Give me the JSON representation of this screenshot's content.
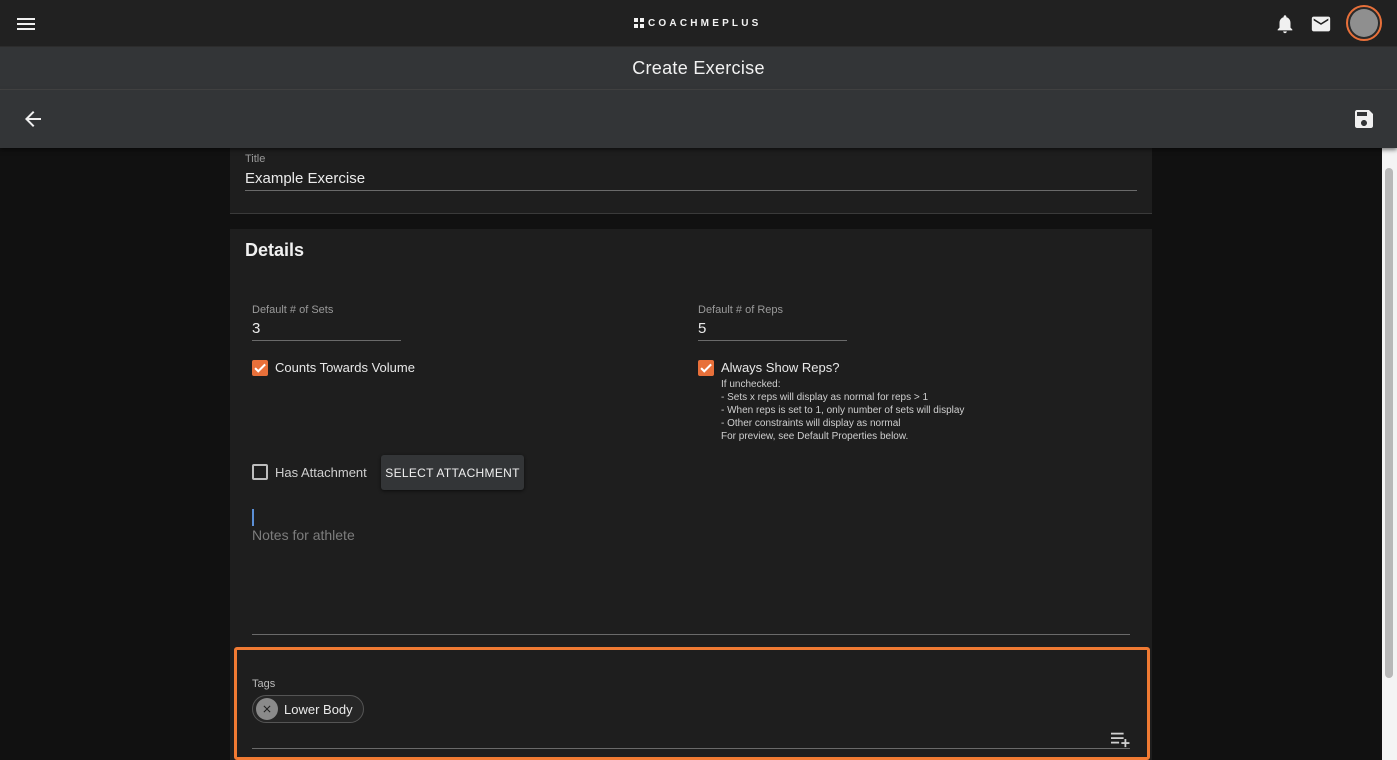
{
  "app": {
    "brand": "COACHMEPLUS"
  },
  "header": {
    "title": "Create Exercise"
  },
  "form": {
    "title_label": "Title",
    "title_value": "Example Exercise",
    "details_heading": "Details",
    "sets_label": "Default # of Sets",
    "sets_value": "3",
    "reps_label": "Default # of Reps",
    "reps_value": "5",
    "counts_volume_label": "Counts Towards Volume",
    "counts_volume_checked": true,
    "always_show_reps_label": "Always Show Reps?",
    "always_show_reps_checked": true,
    "help_lines": [
      "If unchecked:",
      "- Sets x reps will display as normal for reps > 1",
      "- When reps is set to 1, only number of sets will display",
      "- Other constraints will display as normal",
      "For preview, see Default Properties below."
    ],
    "has_attachment_label": "Has Attachment",
    "has_attachment_checked": false,
    "select_attachment_label": "SELECT ATTACHMENT",
    "notes_placeholder": "Notes for athlete",
    "tags_label": "Tags",
    "tags": [
      "Lower Body"
    ]
  },
  "colors": {
    "accent": "#e8703a",
    "highlight_border": "#f07a33",
    "background": "#111111",
    "card": "#1e1e1e",
    "toolbar": "#333537"
  },
  "icons": {
    "menu": "menu-icon",
    "notifications": "bell-icon",
    "messages": "mail-icon",
    "back": "arrow-left-icon",
    "save": "save-icon",
    "chip_remove": "close-icon",
    "add_tag": "playlist-add-icon"
  }
}
